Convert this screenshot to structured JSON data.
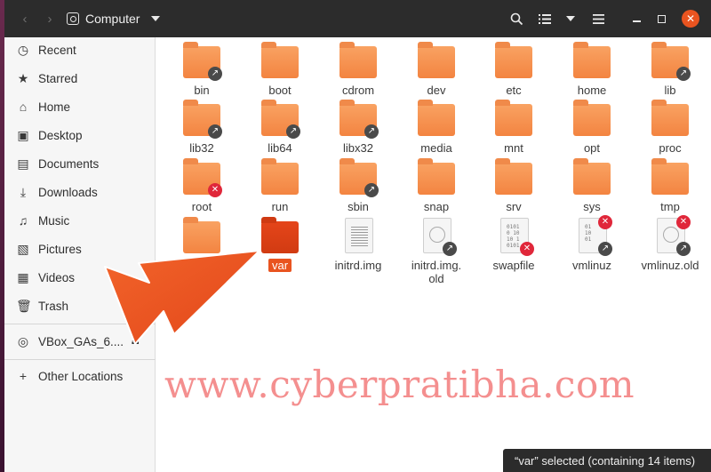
{
  "header": {
    "title": "Computer",
    "back_icon": "chevron-left-icon",
    "forward_icon": "chevron-right-icon",
    "location_icon": "drive-icon"
  },
  "sidebar": {
    "items": [
      {
        "label": "Recent",
        "icon": "clock-icon"
      },
      {
        "label": "Starred",
        "icon": "star-icon"
      },
      {
        "label": "Home",
        "icon": "home-icon"
      },
      {
        "label": "Desktop",
        "icon": "desktop-icon"
      },
      {
        "label": "Documents",
        "icon": "document-icon"
      },
      {
        "label": "Downloads",
        "icon": "download-icon"
      },
      {
        "label": "Music",
        "icon": "music-icon"
      },
      {
        "label": "Pictures",
        "icon": "pictures-icon"
      },
      {
        "label": "Videos",
        "icon": "video-icon"
      },
      {
        "label": "Trash",
        "icon": "trash-icon"
      }
    ],
    "device": {
      "label": "VBox_GAs_6....",
      "icon": "disc-icon"
    },
    "other": {
      "label": "Other Locations",
      "icon": "plus-icon"
    }
  },
  "files": [
    {
      "name": "bin"
    },
    {
      "name": "boot"
    },
    {
      "name": "cdrom"
    },
    {
      "name": "dev"
    },
    {
      "name": "etc"
    },
    {
      "name": "home"
    },
    {
      "name": "lib"
    },
    {
      "name": "lib32"
    },
    {
      "name": "lib64"
    },
    {
      "name": "libx32"
    },
    {
      "name": "media"
    },
    {
      "name": "mnt"
    },
    {
      "name": "opt"
    },
    {
      "name": "proc"
    },
    {
      "name": "root"
    },
    {
      "name": "run"
    },
    {
      "name": "sbin"
    },
    {
      "name": "snap"
    },
    {
      "name": "srv"
    },
    {
      "name": "sys"
    },
    {
      "name": "tmp"
    },
    {
      "name": ""
    },
    {
      "name": "var"
    },
    {
      "name": "initrd.img"
    },
    {
      "name": "initrd.img.\nold"
    },
    {
      "name": "swapfile"
    },
    {
      "name": "vmlinuz"
    },
    {
      "name": "vmlinuz.old"
    }
  ],
  "watermark": "www.cyberpratibha.com",
  "status": "“var” selected  (containing 14 items)",
  "colors": {
    "accent": "#e95420",
    "folder": "#f38441",
    "headerbar": "#2c2c2c"
  }
}
